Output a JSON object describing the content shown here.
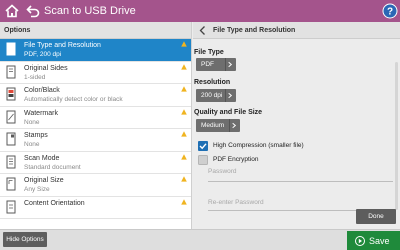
{
  "header": {
    "title": "Scan to USB Drive",
    "help_glyph": "?"
  },
  "options_panel": {
    "heading": "Options",
    "items": [
      {
        "name": "File Type and Resolution",
        "value": "PDF, 200 dpi",
        "icon": "file-type-icon",
        "selected": true,
        "warning": true
      },
      {
        "name": "Original Sides",
        "value": "1-sided",
        "icon": "original-sides-icon",
        "selected": false,
        "warning": true
      },
      {
        "name": "Color/Black",
        "value": "Automatically detect color or black",
        "icon": "color-black-icon",
        "selected": false,
        "warning": true
      },
      {
        "name": "Watermark",
        "value": "None",
        "icon": "watermark-icon",
        "selected": false,
        "warning": true
      },
      {
        "name": "Stamps",
        "value": "None",
        "icon": "stamps-icon",
        "selected": false,
        "warning": true
      },
      {
        "name": "Scan Mode",
        "value": "Standard document",
        "icon": "scan-mode-icon",
        "selected": false,
        "warning": true
      },
      {
        "name": "Original Size",
        "value": "Any Size",
        "icon": "original-size-icon",
        "selected": false,
        "warning": true
      },
      {
        "name": "Content Orientation",
        "value": "",
        "icon": "content-orientation-icon",
        "selected": false,
        "warning": true
      }
    ]
  },
  "detail_panel": {
    "title": "File Type and Resolution",
    "file_type": {
      "label": "File Type",
      "value": "PDF"
    },
    "resolution": {
      "label": "Resolution",
      "value": "200 dpi"
    },
    "quality": {
      "label": "Quality and File Size",
      "value": "Medium"
    },
    "high_compression": {
      "label": "High Compression (smaller file)",
      "checked": true
    },
    "pdf_encryption": {
      "label": "PDF Encryption",
      "checked": false
    },
    "password_placeholder": "Password",
    "reenter_placeholder": "Re-enter Password",
    "done_label": "Done"
  },
  "footer": {
    "hide_options_label": "Hide Options",
    "save_label": "Save"
  },
  "colors": {
    "header": "#a4548c",
    "selected": "#1f85c8",
    "save": "#1f8a3b",
    "checkbox": "#1f6fb4"
  }
}
